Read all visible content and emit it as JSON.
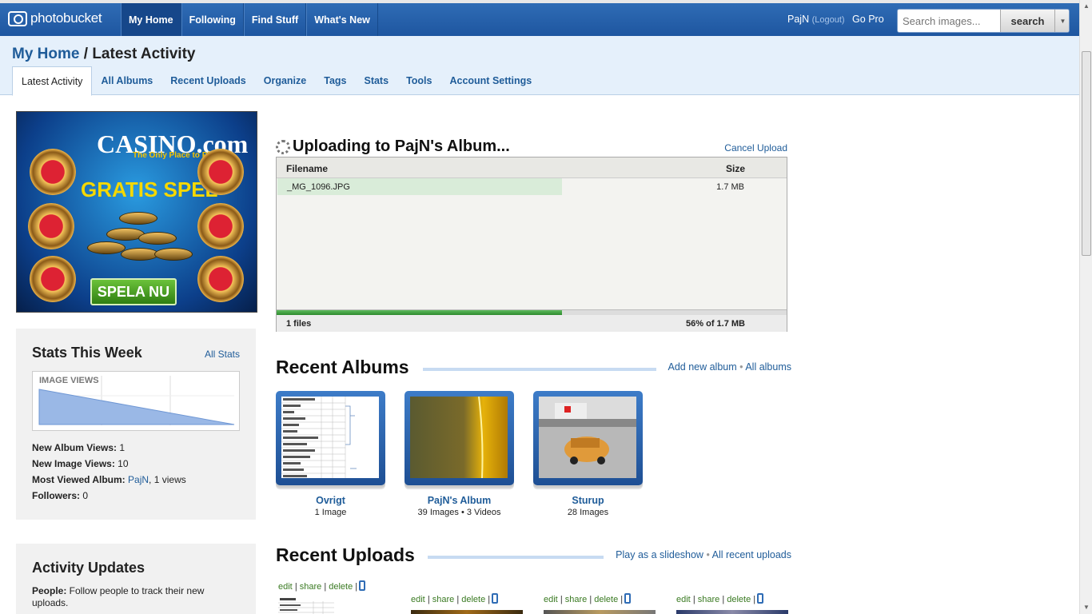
{
  "brand": {
    "name": "photobucket"
  },
  "topnav": [
    {
      "label": "My Home",
      "active": true
    },
    {
      "label": "Following",
      "active": false
    },
    {
      "label": "Find Stuff",
      "active": false
    },
    {
      "label": "What's New",
      "active": false
    }
  ],
  "user": {
    "name": "PajN",
    "logout_label": "(Logout)",
    "gopro_label": "Go Pro"
  },
  "search": {
    "placeholder": "Search images...",
    "button_label": "search",
    "dropdown_icon": "▼"
  },
  "breadcrumb": {
    "home": "My Home",
    "separator": " / ",
    "current": "Latest Activity"
  },
  "subnav": [
    {
      "label": "Latest Activity",
      "active": true
    },
    {
      "label": "All Albums",
      "active": false
    },
    {
      "label": "Recent Uploads",
      "active": false
    },
    {
      "label": "Organize",
      "active": false
    },
    {
      "label": "Tags",
      "active": false
    },
    {
      "label": "Stats",
      "active": false
    },
    {
      "label": "Tools",
      "active": false
    },
    {
      "label": "Account Settings",
      "active": false
    }
  ],
  "ad": {
    "logo": "CASINO.com",
    "tagline": "The Only Place to Play",
    "headline": "GRATIS SPEL",
    "cta": "SPELA NU"
  },
  "stats": {
    "title": "Stats This Week",
    "all_link": "All Stats",
    "chart_label": "IMAGE VIEWS",
    "new_album_views_label": "New Album Views:",
    "new_album_views": "1",
    "new_image_views_label": "New Image Views:",
    "new_image_views": "10",
    "most_viewed_label": "Most Viewed Album:",
    "most_viewed_album": "PajN",
    "most_viewed_views": ", 1 views",
    "followers_label": "Followers:",
    "followers": "0"
  },
  "activity": {
    "title": "Activity Updates",
    "people_label": "People:",
    "people_text": " Follow people to track their new uploads."
  },
  "upload": {
    "title": "Uploading to PajN's Album...",
    "cancel_label": "Cancel Upload",
    "col_filename": "Filename",
    "col_size": "Size",
    "file": {
      "name": "_MG_1096.JPG",
      "size": "1.7 MB",
      "progress": 0.56
    },
    "files_count": "1 files",
    "progress_text": "56% of 1.7 MB"
  },
  "recent_albums": {
    "title": "Recent Albums",
    "add_link": "Add new album",
    "all_link": "All albums",
    "separator": "•",
    "albums": [
      {
        "name": "Ovrigt",
        "count": "1 Image"
      },
      {
        "name": "PajN's Album",
        "count": "39 Images • 3 Videos"
      },
      {
        "name": "Sturup",
        "count": "28 Images"
      }
    ]
  },
  "recent_uploads": {
    "title": "Recent Uploads",
    "slideshow_link": "Play as a slideshow",
    "all_link": "All recent uploads",
    "separator": "•",
    "action_edit": "edit",
    "action_share": "share",
    "action_delete": "delete",
    "action_sep": "|"
  },
  "colors": {
    "brand_blue": "#2f6cb5",
    "progress_green": "#2e8a2e",
    "link": "#1f5c99"
  }
}
